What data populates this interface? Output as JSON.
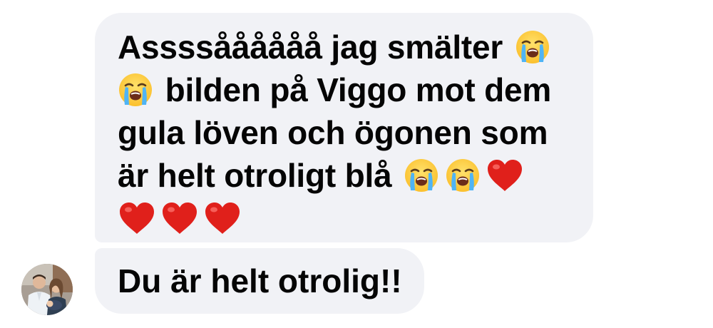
{
  "conversation": {
    "messages": [
      {
        "id": "msg-1",
        "lines": [
          {
            "text_before": "Assssåååååå jag smälter",
            "emojis_after": [
              "loudly-crying-face-icon"
            ]
          },
          {
            "emojis_before": [
              "loudly-crying-face-icon"
            ],
            "text_after": "bilden på Viggo mot dem"
          },
          {
            "text": "gula löven och ögonen som"
          },
          {
            "text_before": "är helt otroligt blå",
            "emojis_after": [
              "loudly-crying-face-icon",
              "loudly-crying-face-icon",
              "red-heart-icon"
            ]
          },
          {
            "emojis": [
              "red-heart-icon",
              "red-heart-icon",
              "red-heart-icon"
            ]
          }
        ]
      },
      {
        "id": "msg-2",
        "text": "Du är helt otrolig!!"
      }
    ],
    "sender_avatar": "avatar-photo-couple"
  },
  "colors": {
    "bubble_background": "#f1f2f6",
    "text": "#050505",
    "heart": "#e0201b",
    "emoji_face": "#fbc02d"
  }
}
